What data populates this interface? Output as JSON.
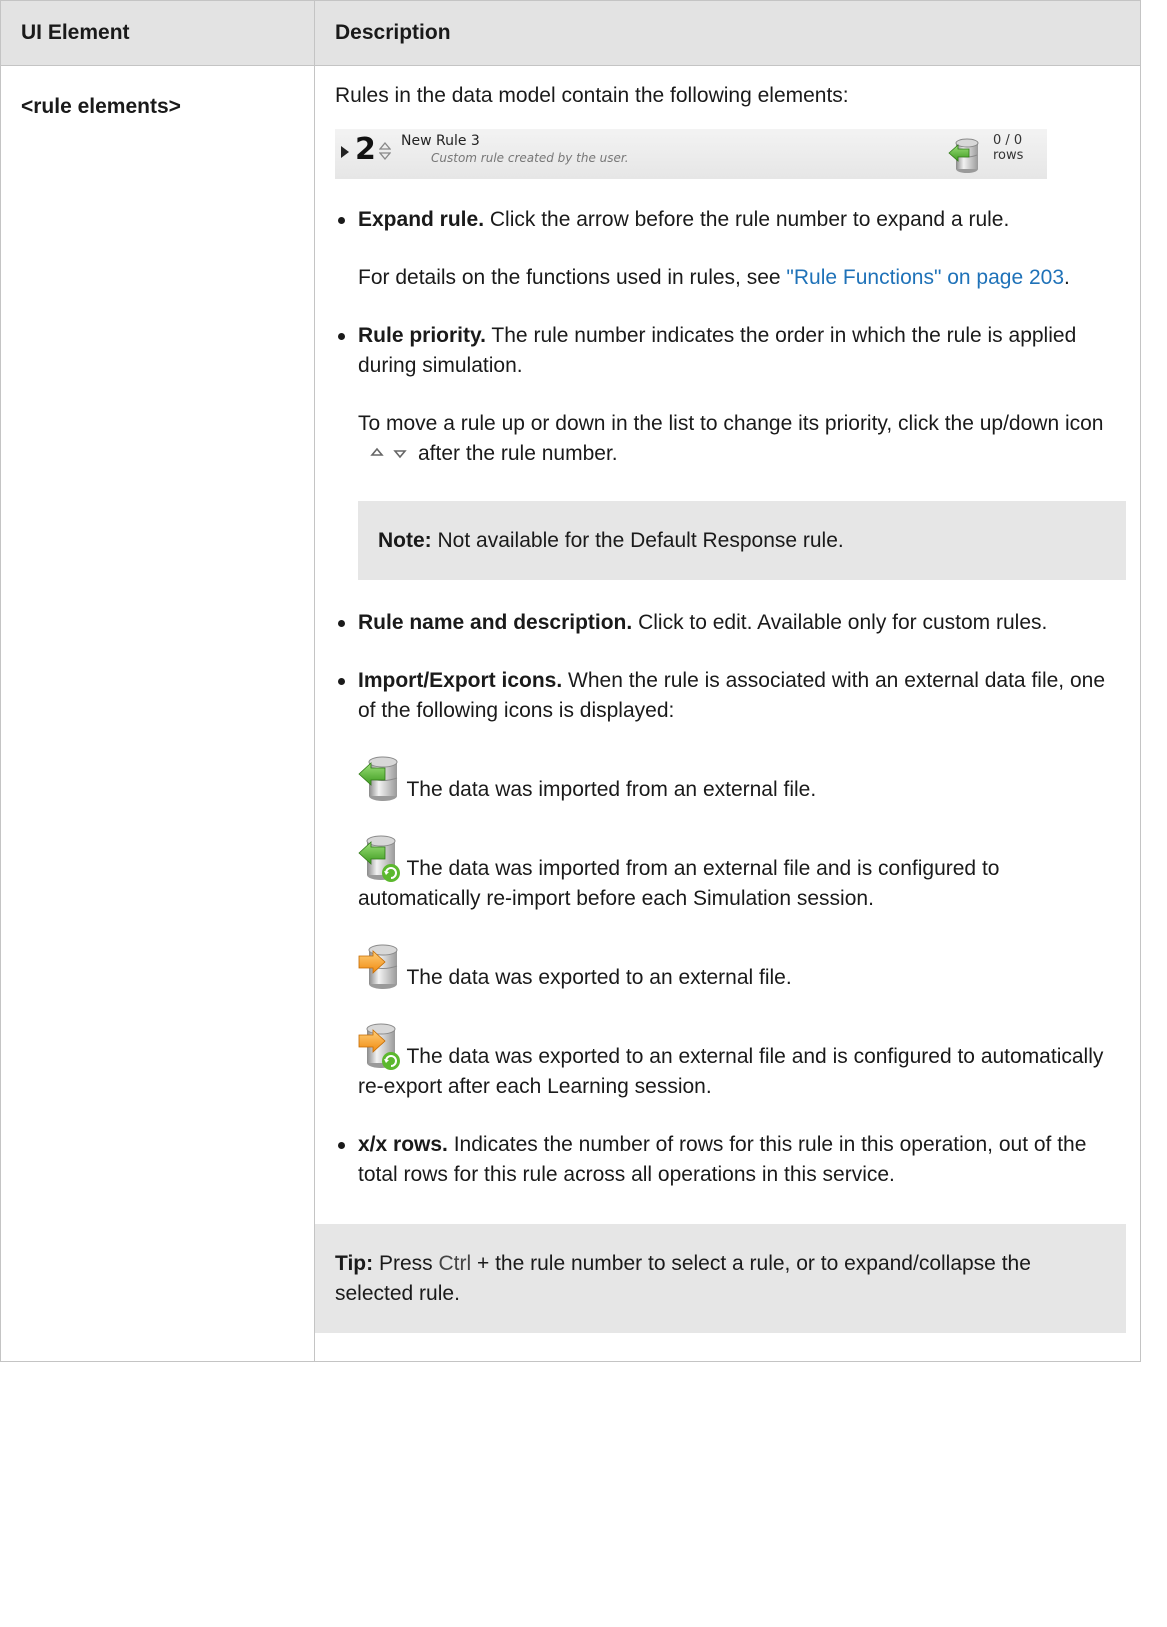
{
  "table": {
    "header_col1": "UI Element",
    "header_col2": "Description"
  },
  "row": {
    "element": "<rule elements>",
    "intro": "Rules in the data model contain the following elements:"
  },
  "rule_bar": {
    "number": "2",
    "name": "New Rule 3",
    "description": "Custom rule created by the user.",
    "rows": "0 / 0 rows"
  },
  "expand": {
    "title": "Expand rule.",
    "text": " Click the arrow before the rule number to expand a rule.",
    "details_prefix": "For details on the functions used in rules, see ",
    "link": "\"Rule Functions\" on page 203",
    "details_suffix": "."
  },
  "priority": {
    "title": "Rule priority.",
    "text": " The rule number indicates the order in which the rule is applied during simulation.",
    "move_prefix": "To move a rule up or down in the list to change its priority, click the up/down icon",
    "move_suffix": "after the rule number.",
    "note_label": "Note:",
    "note_text": " Not available for the Default Response rule."
  },
  "name_desc": {
    "title": "Rule name and description.",
    "text": " Click to edit. Available only for custom rules."
  },
  "import_export": {
    "title": "Import/Export icons.",
    "text": " When the rule is associated with an external data file, one of the following icons is displayed:",
    "icons": [
      {
        "icon": "database-import-icon",
        "text": "The data was imported from an external file."
      },
      {
        "icon": "database-import-refresh-icon",
        "text": "The data was imported from an external file and is configured to automatically re-import before each Simulation session."
      },
      {
        "icon": "database-export-icon",
        "text": "The data was exported to an external file."
      },
      {
        "icon": "database-export-refresh-icon",
        "text": "The data was exported to an external file and is configured to automatically re-export after each Learning session."
      }
    ]
  },
  "rows_item": {
    "title": "x/x rows.",
    "text": " Indicates the number of rows for this rule in this operation, out of the total rows for this rule across all operations in this service."
  },
  "tip": {
    "label": "Tip:",
    "prefix": " Press ",
    "key": "Ctrl",
    "suffix": " + the rule number to select a rule, or to expand/collapse the selected rule."
  },
  "colors": {
    "header_bg": "#e3e3e3",
    "note_bg": "#e6e6e6",
    "link": "#1f72b8",
    "border": "#c4c4c4"
  }
}
